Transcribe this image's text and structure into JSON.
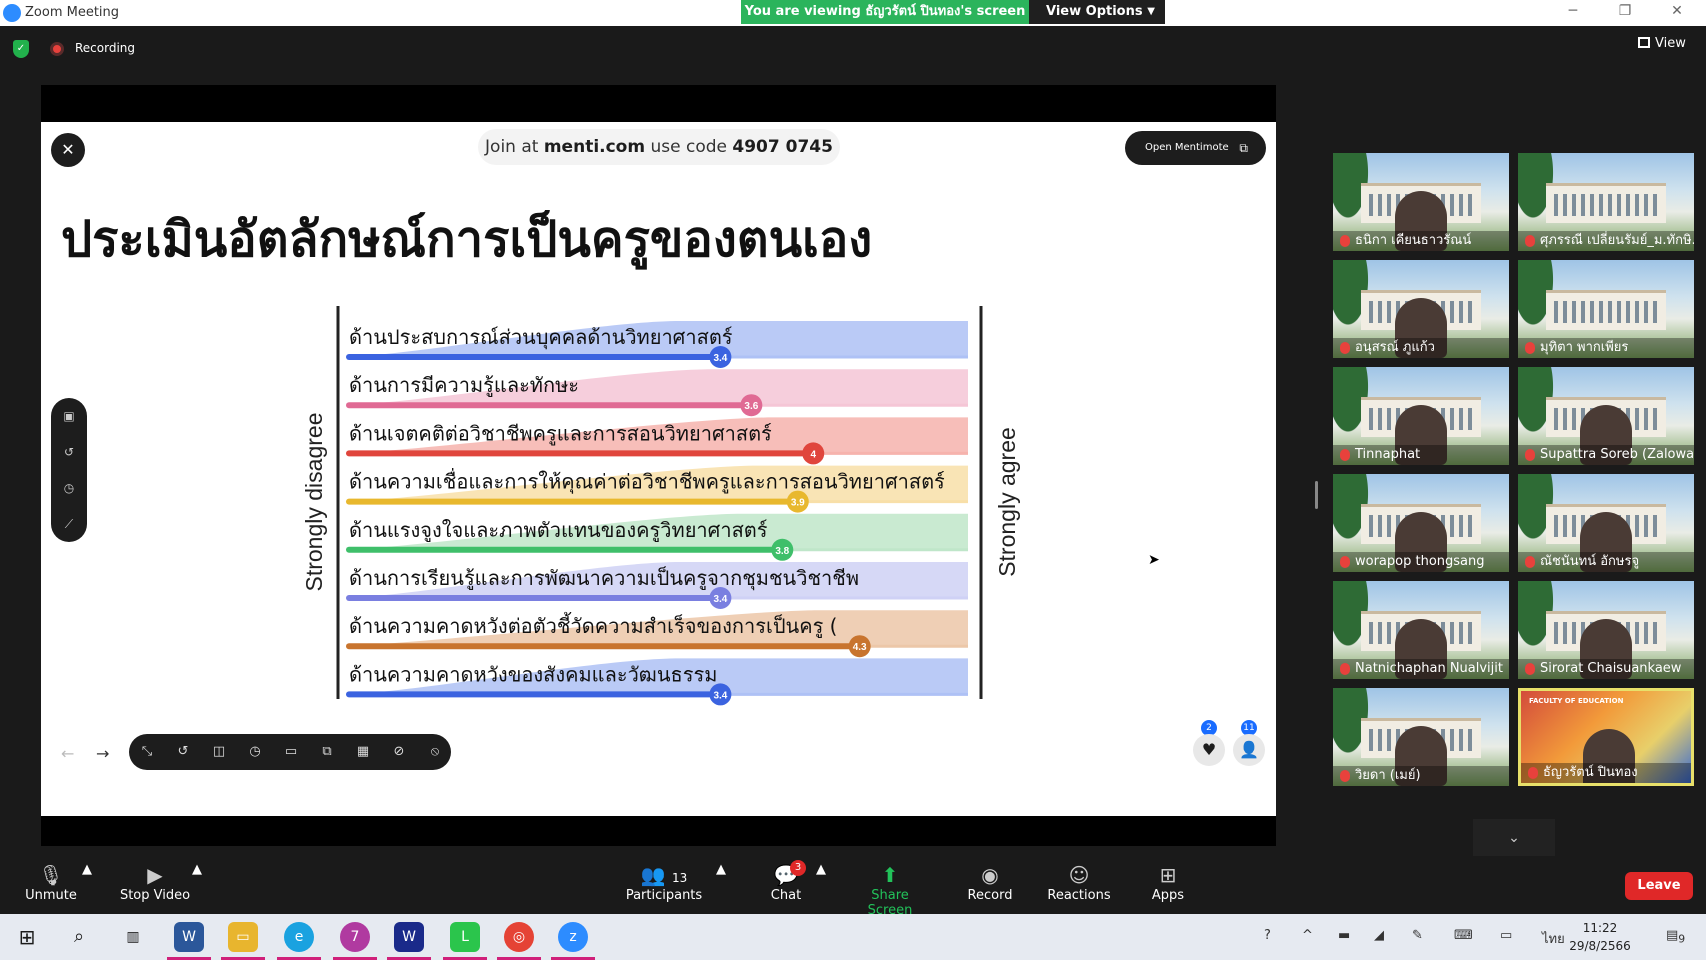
{
  "titlebar": {
    "app_title": "Zoom Meeting",
    "viewing_banner": "You are viewing ธัญวรัตน์ ปินทอง's screen",
    "view_options": "View Options",
    "minimize": "─",
    "restore": "❐",
    "close": "✕"
  },
  "meeting": {
    "recording_label": "Recording",
    "view_label": "View"
  },
  "slide": {
    "close_symbol": "✕",
    "join_prefix": "Join at",
    "join_site": "menti.com",
    "join_mid": "use code",
    "join_code": "4907 0745",
    "open_mentimote": "Open Mentimote",
    "title": "ประเมินอัตลักษณ์การเป็นครูของตนเอง",
    "reactions": {
      "hearts": "2",
      "participants": "11"
    }
  },
  "chart_data": {
    "type": "bar",
    "left_label": "Strongly disagree",
    "right_label": "Strongly agree",
    "scale": [
      1,
      5
    ],
    "categories": [
      "ด้านประสบการณ์ส่วนบุคคลด้านวิทยาศาสตร์",
      "ด้านการมีความรู้และทักษะ",
      "ด้านเจตคติต่อวิชาชีพครูและการสอนวิทยาศาสตร์",
      "ด้านความเชื่อและการให้คุณค่าต่อวิชาชีพครูและการสอนวิทยาศาสตร์",
      "ด้านแรงจูงใจและภาพตัวแทนของครูวิทยาศาสตร์",
      "ด้านการเรียนรู้และการพัฒนาความเป็นครูจากชุมชนวิชาชีพ",
      "ด้านความคาดหวังต่อตัวชี้วัดความสำเร็จของการเป็นครู (",
      "ด้านความคาดหวังของสังคมและวัฒนธรรม"
    ],
    "values": [
      3.4,
      3.6,
      4,
      3.9,
      3.8,
      3.4,
      4.3,
      3.4
    ],
    "value_labels": [
      "3.4",
      "3.6",
      "4",
      "3.9",
      "3.8",
      "3.4",
      "4.3",
      "3.4"
    ],
    "colors": [
      "#3b63e0",
      "#e06a94",
      "#e0453c",
      "#e8b82e",
      "#3fbf6a",
      "#7a7fe0",
      "#c8742e",
      "#3b63e0"
    ],
    "fills": [
      "#aec1f5",
      "#f5c6d6",
      "#f6b3ad",
      "#f8dfa8",
      "#bfe6c9",
      "#cfd1f5",
      "#ecc7a8",
      "#aec1f5"
    ]
  },
  "gallery": [
    {
      "name": "ธนิกา เคียนธาวรัณน์"
    },
    {
      "name": "ศุภรรณี เปลี่ยนรัมย์_ม.ทักษิ..."
    },
    {
      "name": "อนุสรณ์ ภูแก้ว"
    },
    {
      "name": "มุทิตา พากเพียร"
    },
    {
      "name": "Tinnaphat"
    },
    {
      "name": "Supattra Soreb (Zalowa)"
    },
    {
      "name": "worapop thongsang"
    },
    {
      "name": "ณัชนันทน์ อักษรจู"
    },
    {
      "name": "Natnichaphan Nualvijit"
    },
    {
      "name": "Sirorat Chaisuankaew"
    },
    {
      "name": "วิยดา (เมย์)"
    },
    {
      "name": "ธัญวรัตน์ ปินทอง"
    }
  ],
  "active_tile_caption": "FACULTY OF EDUCATION",
  "toolbar": {
    "unmute": "Unmute",
    "stop_video": "Stop Video",
    "participants": "Participants",
    "participants_count": "13",
    "chat": "Chat",
    "chat_badge": "3",
    "share_screen": "Share Screen",
    "record": "Record",
    "reactions": "Reactions",
    "apps": "Apps",
    "leave": "Leave"
  },
  "taskbar": {
    "lang": "ไทย",
    "time": "11:22",
    "date": "29/8/2566",
    "notif_count": "9",
    "app_badge": "7"
  }
}
